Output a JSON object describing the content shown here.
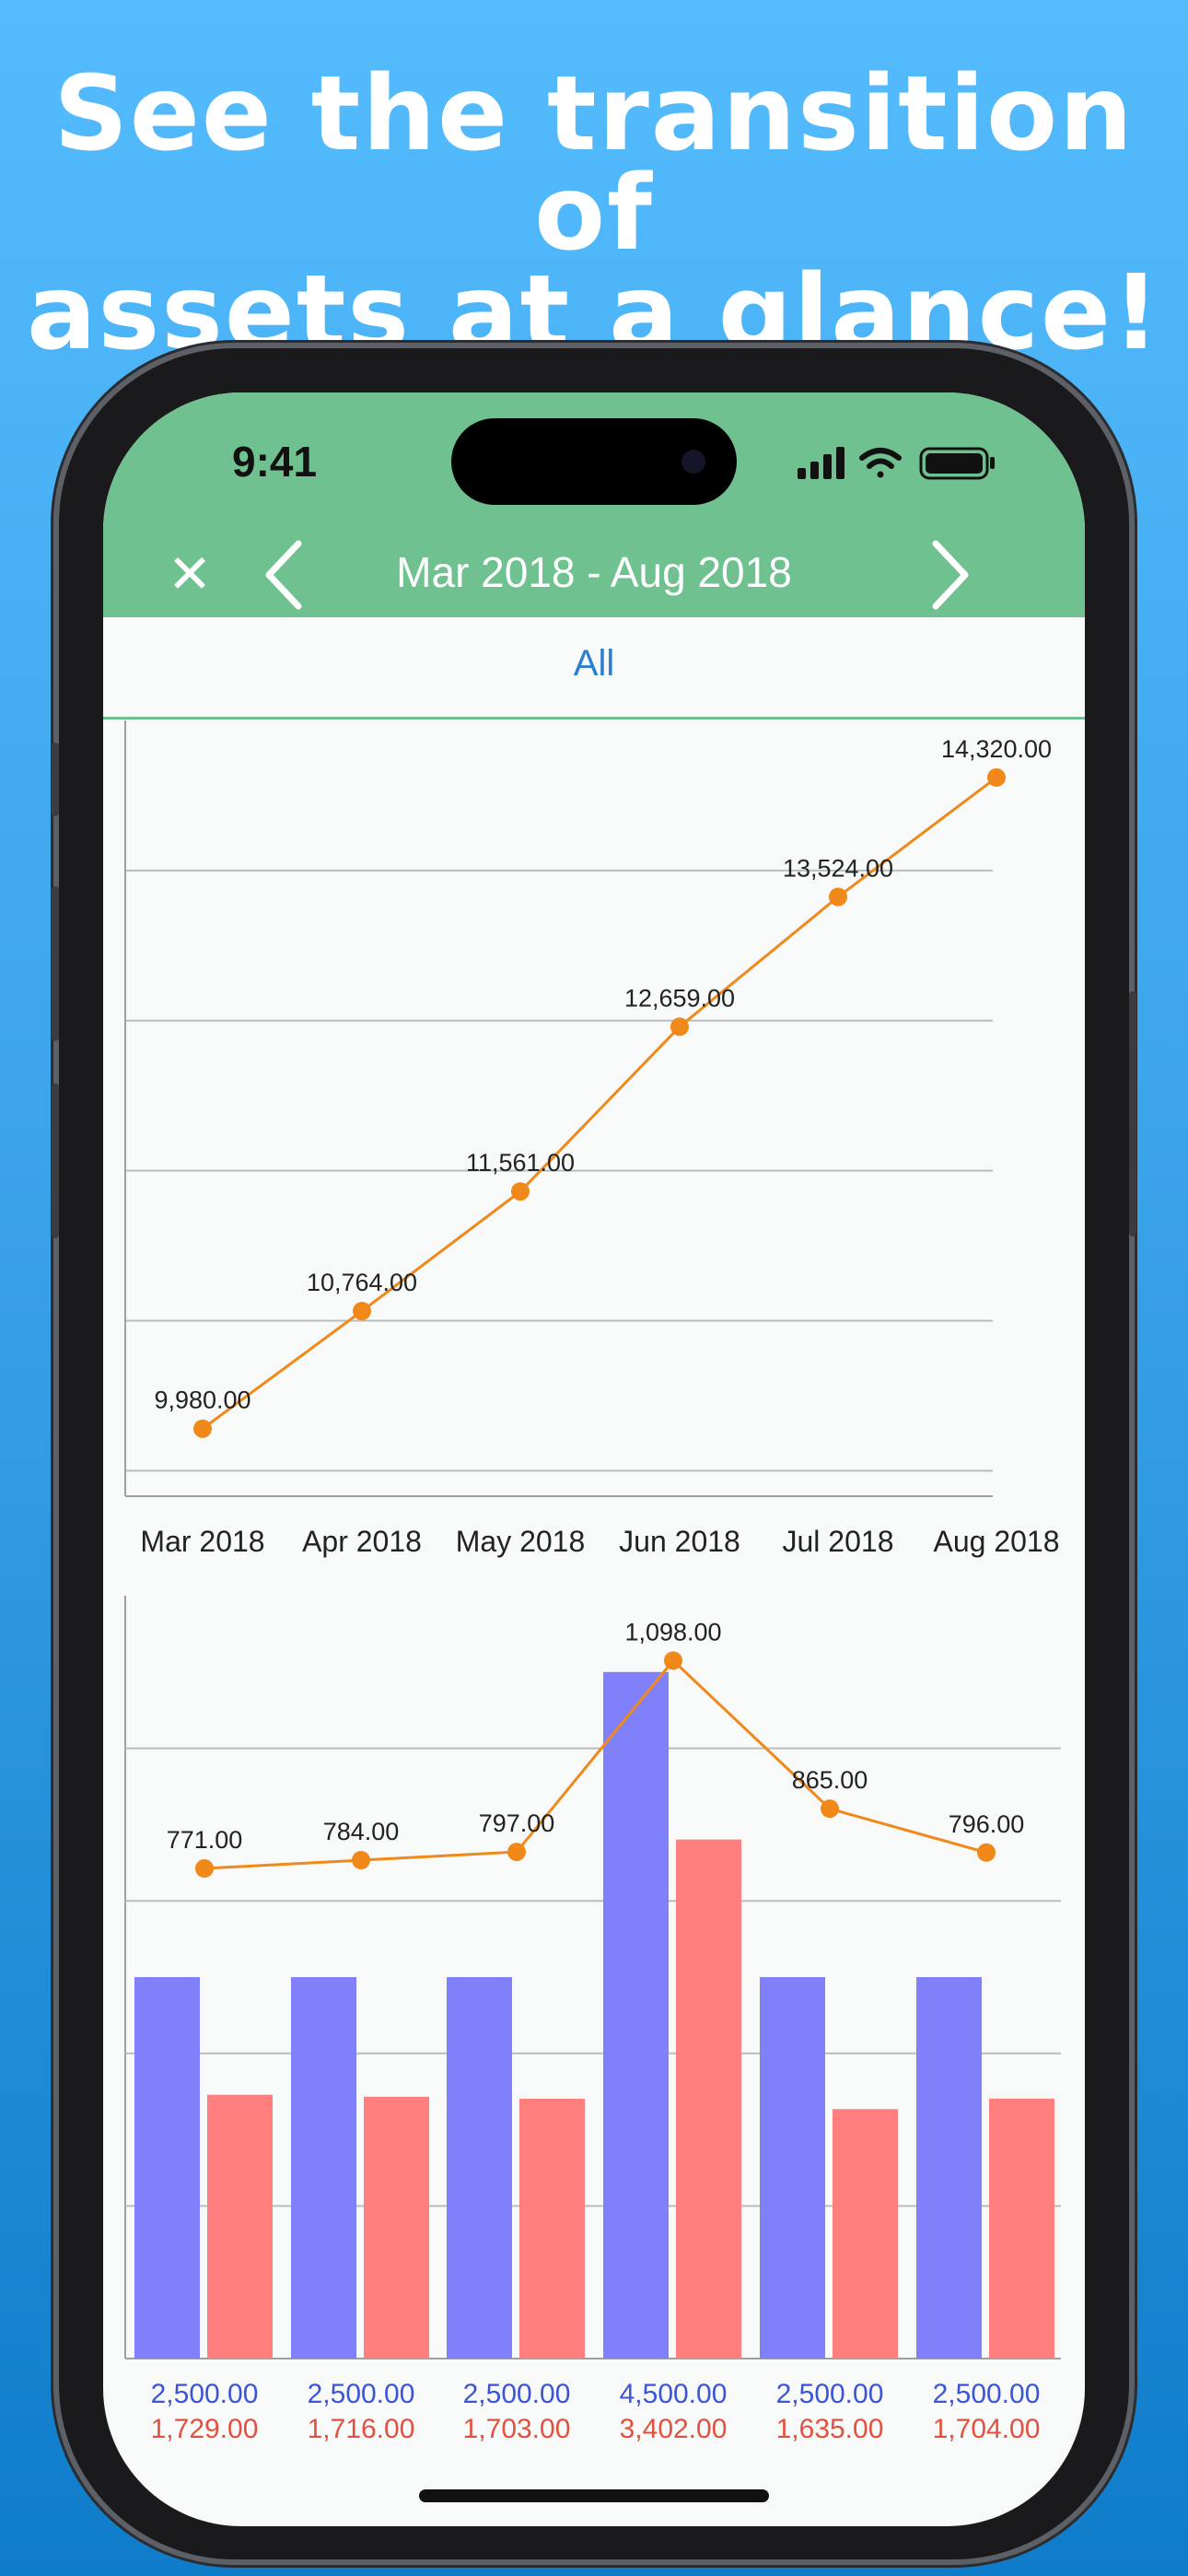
{
  "headline": {
    "line1": "See the transition of",
    "line2": "assets at a glance!"
  },
  "status_bar": {
    "time": "9:41"
  },
  "nav": {
    "title": "Mar 2018 - Aug 2018",
    "close_icon": "close-icon",
    "prev_icon": "chevron-left-icon",
    "next_icon": "chevron-right-icon"
  },
  "segment": {
    "selected": "All"
  },
  "colors": {
    "header_green": "#6fc28f",
    "line_orange": "#f0891a",
    "bar_blue": "#8080fa",
    "bar_red": "#ff7f7f",
    "label_blue": "#3c55d6",
    "label_red": "#e2513f"
  },
  "chart_data": [
    {
      "type": "line",
      "categories": [
        "Mar 2018",
        "Apr 2018",
        "May 2018",
        "Jun 2018",
        "Jul 2018",
        "Aug 2018"
      ],
      "values": [
        9980.0,
        10764.0,
        11561.0,
        12659.0,
        13524.0,
        14320.0
      ],
      "value_labels": [
        "9,980.00",
        "10,764.00",
        "11,561.00",
        "12,659.00",
        "13,524.00",
        "14,320.00"
      ],
      "title": "",
      "xlabel": "",
      "ylabel": "",
      "ylim": [
        9530,
        14700
      ],
      "grid": true,
      "legend": "none"
    },
    {
      "type": "bar",
      "series": [
        {
          "name": "",
          "values": [
            2500.0,
            2500.0,
            2500.0,
            4500.0,
            2500.0,
            2500.0
          ],
          "labels": [
            "2,500.00",
            "2,500.00",
            "2,500.00",
            "4,500.00",
            "2,500.00",
            "2,500.00"
          ]
        },
        {
          "name": "",
          "values": [
            1729.0,
            1716.0,
            1703.0,
            3402.0,
            1635.0,
            1704.0
          ],
          "labels": [
            "1,729.00",
            "1,716.00",
            "1,703.00",
            "3,402.00",
            "1,635.00",
            "1,704.00"
          ]
        }
      ],
      "line": {
        "values": [
          771.0,
          784.0,
          797.0,
          1098.0,
          865.0,
          796.0
        ],
        "labels": [
          "771.00",
          "784.00",
          "797.00",
          "1,098.00",
          "865.00",
          "796.00"
        ]
      },
      "title": "",
      "xlabel": "",
      "ylabel": "",
      "grid": true,
      "legend": "none"
    }
  ]
}
